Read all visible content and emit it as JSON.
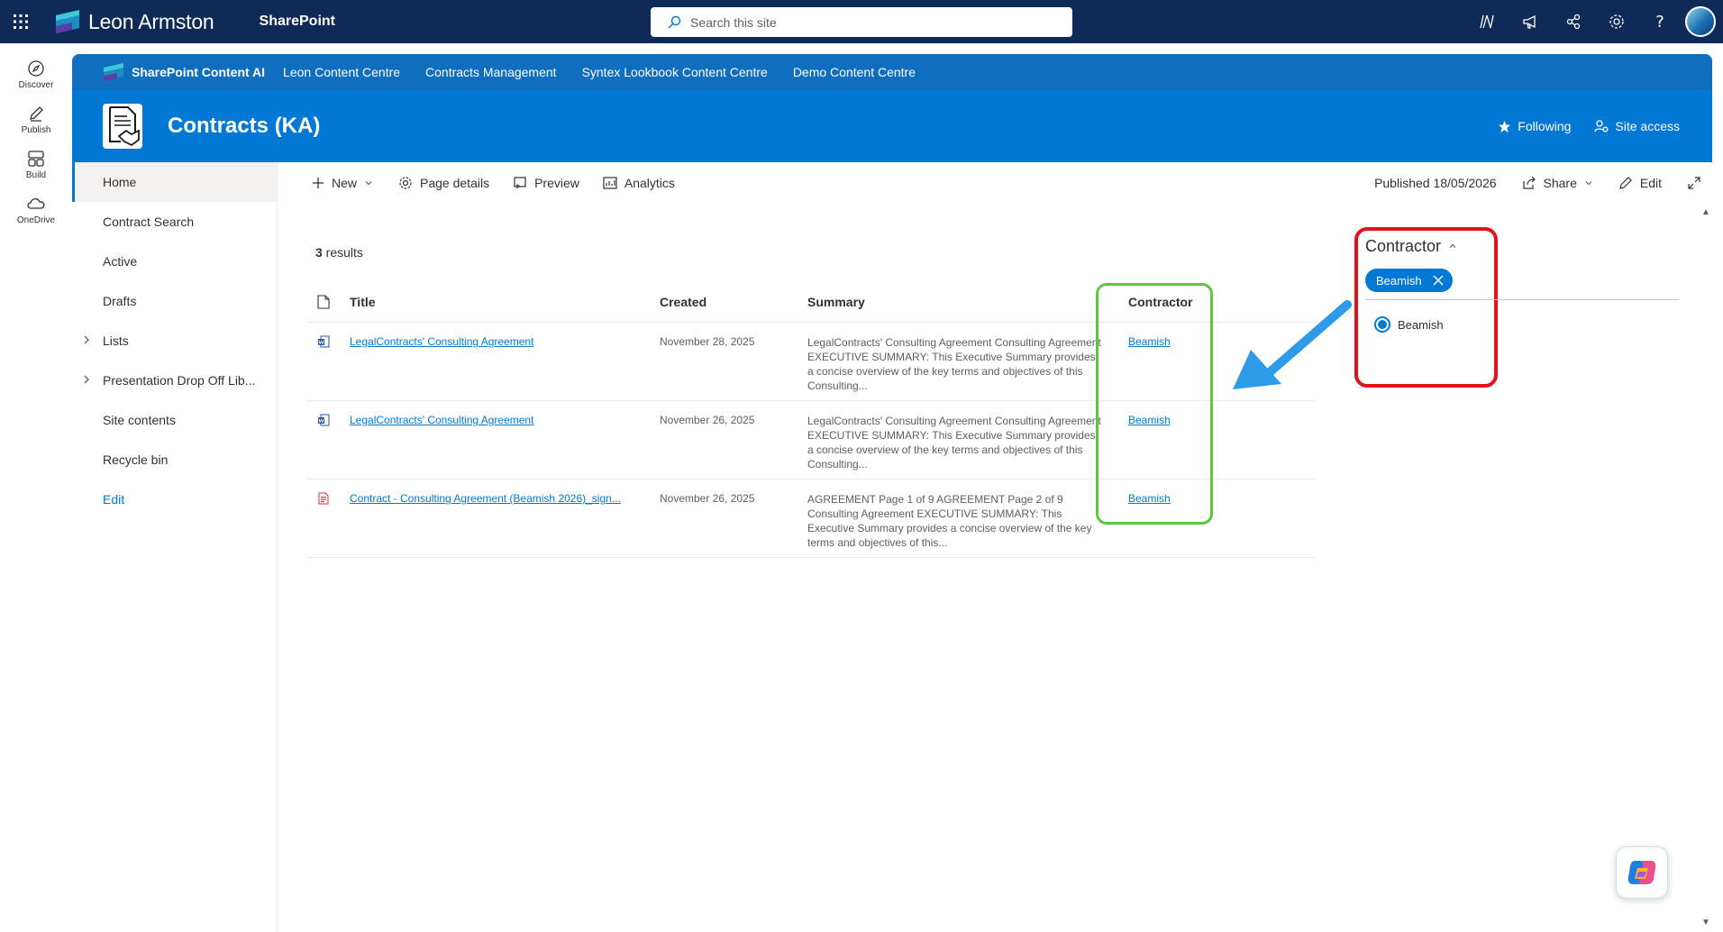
{
  "suite": {
    "brand_name": "Leon Armston",
    "app_name": "SharePoint",
    "search_placeholder": "Search this site"
  },
  "appbar": {
    "items": [
      {
        "label": "Discover",
        "icon": "compass-icon"
      },
      {
        "label": "Publish",
        "icon": "pen-icon"
      },
      {
        "label": "Build",
        "icon": "grid-icon"
      },
      {
        "label": "OneDrive",
        "icon": "cloud-icon"
      }
    ]
  },
  "hub": {
    "title": "SharePoint Content AI",
    "links": [
      "Leon Content Centre",
      "Contracts Management",
      "Syntex Lookbook Content Centre",
      "Demo Content Centre"
    ]
  },
  "site": {
    "title": "Contracts (KA)",
    "following_label": "Following",
    "site_access_label": "Site access"
  },
  "leftnav": {
    "items": [
      {
        "label": "Home",
        "active": true,
        "chevron": false
      },
      {
        "label": "Contract Search",
        "active": false,
        "chevron": false
      },
      {
        "label": "Active",
        "active": false,
        "chevron": false
      },
      {
        "label": "Drafts",
        "active": false,
        "chevron": false
      },
      {
        "label": "Lists",
        "active": false,
        "chevron": true
      },
      {
        "label": "Presentation Drop Off Lib...",
        "active": false,
        "chevron": true
      },
      {
        "label": "Site contents",
        "active": false,
        "chevron": false
      },
      {
        "label": "Recycle bin",
        "active": false,
        "chevron": false
      }
    ],
    "edit_label": "Edit"
  },
  "commandbar": {
    "new_label": "New",
    "page_details_label": "Page details",
    "preview_label": "Preview",
    "analytics_label": "Analytics",
    "published_label": "Published 18/05/2026",
    "share_label": "Share",
    "edit_label": "Edit"
  },
  "results": {
    "count": "3",
    "count_suffix": " results",
    "headers": {
      "title": "Title",
      "created": "Created",
      "summary": "Summary",
      "contractor": "Contractor"
    },
    "rows": [
      {
        "file_type": "word-doc-icon",
        "title": "LegalContracts' Consulting Agreement",
        "created": "November 28, 2025",
        "summary": "LegalContracts' Consulting Agreement Consulting Agreement EXECUTIVE SUMMARY: This Executive Summary provides a concise overview of the key terms and objectives of this Consulting...",
        "contractor": "Beamish"
      },
      {
        "file_type": "word-doc-icon",
        "title": "LegalContracts' Consulting Agreement",
        "created": "November 26, 2025",
        "summary": "LegalContracts' Consulting Agreement Consulting Agreement EXECUTIVE SUMMARY: This Executive Summary provides a concise overview of the key terms and objectives of this Consulting...",
        "contractor": "Beamish"
      },
      {
        "file_type": "pdf-icon",
        "title": "Contract - Consulting Agreement (Beamish 2026)_sign...",
        "created": "November 26, 2025",
        "summary": "AGREEMENT Page 1 of 9 AGREEMENT Page 2 of 9 Consulting Agreement EXECUTIVE SUMMARY: This Executive Summary provides a concise overview of the key terms and objectives of this...",
        "contractor": "Beamish"
      }
    ]
  },
  "refiner": {
    "title": "Contractor",
    "chip_label": "Beamish",
    "option_label": "Beamish"
  },
  "colors": {
    "suite_bar": "#0f2a56",
    "site_header": "#0078d4",
    "accent": "#0078d4",
    "highlight_green": "#5ec442",
    "highlight_red": "#e3101e",
    "arrow_blue": "#2e9be8"
  }
}
